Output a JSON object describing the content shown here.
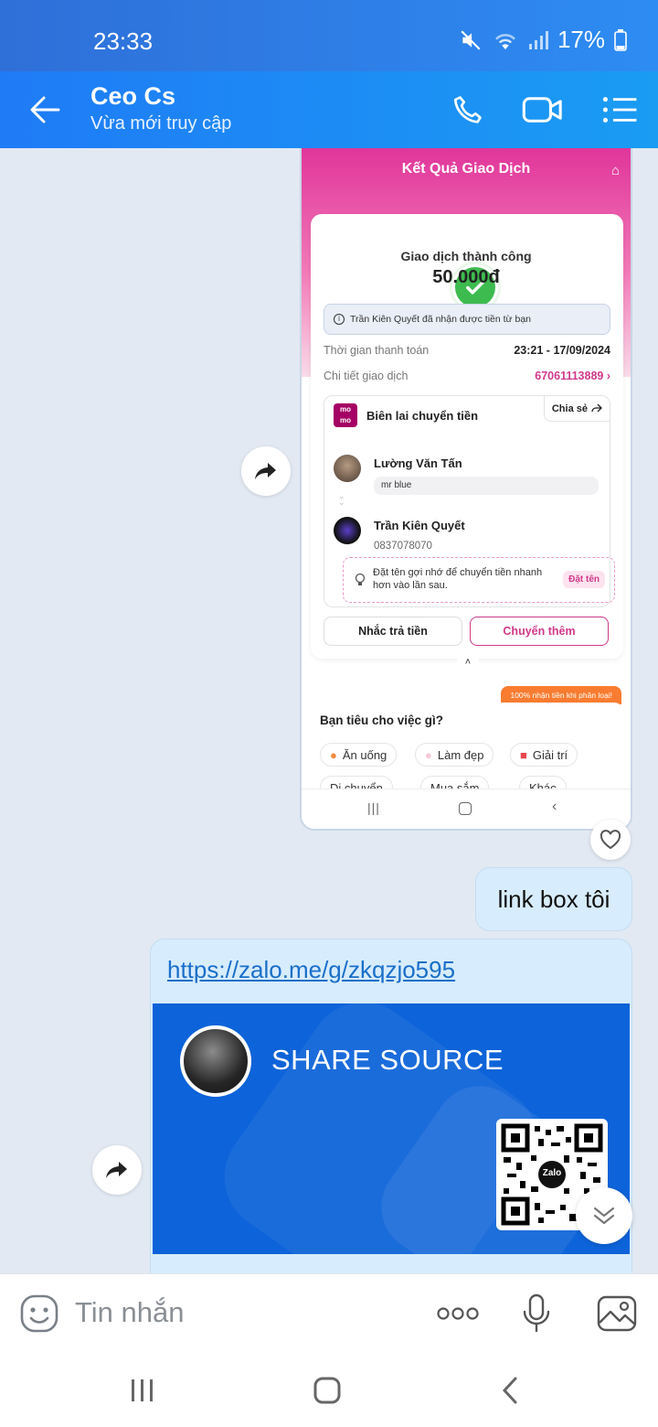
{
  "status_bar": {
    "time": "23:33",
    "battery": "17%"
  },
  "header": {
    "contact_name": "Ceo Cs",
    "status": "Vừa mới truy cập"
  },
  "screenshot": {
    "title": "Kết Quả Giao Dịch",
    "status": "Giao dịch thành công",
    "amount": "50.000đ",
    "info": "Trần Kiên Quyết đã nhận được tiền từ bạn",
    "time_label": "Thời gian thanh toán",
    "time_value": "23:21 - 17/09/2024",
    "detail_label": "Chi tiết giao dịch",
    "detail_value": "67061113889",
    "momo_logo": "mo mo",
    "receipt_title": "Biên lai chuyển tiền",
    "share_label": "Chia sẻ",
    "sender_name": "Lường Văn Tấn",
    "sender_note": "mr blue",
    "receiver_name": "Trần Kiên Quyết",
    "receiver_phone": "0837078070",
    "tip_text": "Đặt tên gợi nhớ để chuyển tiền nhanh hơn vào lần sau.",
    "tip_button": "Đặt tên",
    "remind_button": "Nhắc trả tiền",
    "send_more_button": "Chuyển thêm",
    "promo_tag": "100% nhận tiền khi phân loại!",
    "question": "Bạn tiêu cho việc gì?",
    "chips": [
      "Ăn uống",
      "Làm đẹp",
      "Giải trí",
      "Di chuyển",
      "Mua sắm",
      "Khác"
    ]
  },
  "messages": {
    "text_bubble": "link box tôi",
    "link_url": "https://zalo.me/g/zkqzjo595",
    "group_title": "SHARE SOURCE",
    "qr_label": "Zalo"
  },
  "input": {
    "placeholder": "Tin nhắn"
  },
  "colors": {
    "header": "#1f7bf6",
    "bubble": "#d7ecfd",
    "momo_pink": "#d0398c",
    "banner": "#0d63d9"
  }
}
